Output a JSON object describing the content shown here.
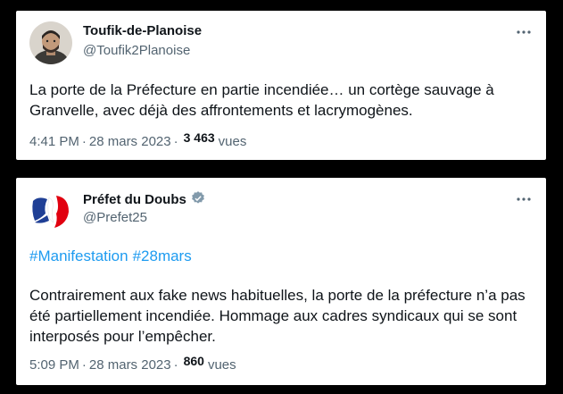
{
  "tweets": [
    {
      "author": {
        "name": "Toufik-de-Planoise",
        "handle": "@Toufik2Planoise",
        "verified": false
      },
      "text": "La porte de la Préfecture en partie incendiée… un cortège sauvage à Granvelle, avec déjà des affrontements et lacrymogènes.",
      "time": "4:41 PM",
      "separator": "·",
      "date": "28 mars 2023",
      "views_count": "3 463",
      "views_label": "vues"
    },
    {
      "author": {
        "name": "Préfet du Doubs",
        "handle": "@Prefet25",
        "verified": true
      },
      "hashtags": [
        "#Manifestation",
        "#28mars"
      ],
      "text": "Contrairement aux fake news habituelles, la porte de la préfecture n’a pas été partiellement incendiée. Hommage aux cadres syndicaux qui se sont interposés pour l’empêcher.",
      "time": "5:09 PM",
      "separator": "·",
      "date": "28 mars 2023",
      "views_count": "860",
      "views_label": "vues"
    }
  ],
  "more_icon": "more-horizontal-icon",
  "verified_badge_color": "#829aab",
  "hashtag_color": "#1d9bf0"
}
